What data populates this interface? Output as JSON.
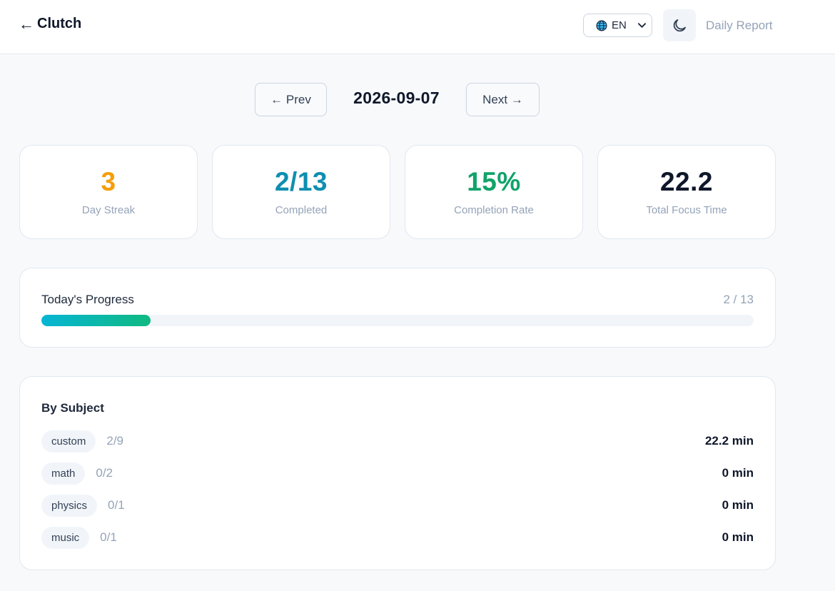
{
  "header": {
    "back_arrow": "←",
    "app_name": "Clutch",
    "language": "EN",
    "title": "Daily Report"
  },
  "date_nav": {
    "prev_label": "← Prev",
    "date": "2026-09-07",
    "next_label": "Next →"
  },
  "stats": [
    {
      "value": "3",
      "label": "Day Streak",
      "color": "#f59e0b"
    },
    {
      "value": "2/13",
      "label": "Completed",
      "color": "#0e8fb0"
    },
    {
      "value": "15%",
      "label": "Completion Rate",
      "color": "#10a36a"
    },
    {
      "value": "22.2",
      "label": "Total Focus Time",
      "color": "#0f172a"
    }
  ],
  "progress": {
    "title": "Today's Progress",
    "count": "2 / 13",
    "fraction": 0.1538
  },
  "by_subject": {
    "title": "By Subject",
    "rows": [
      {
        "subject": "custom",
        "count": "2/9",
        "time": "22.2 min"
      },
      {
        "subject": "math",
        "count": "0/2",
        "time": "0 min"
      },
      {
        "subject": "physics",
        "count": "0/1",
        "time": "0 min"
      },
      {
        "subject": "music",
        "count": "0/1",
        "time": "0 min"
      }
    ]
  },
  "icons": {
    "language": "globe-icon",
    "dropdown": "chevron-down-icon",
    "theme": "moon-icon"
  },
  "colors": {
    "accent_progress_start": "#06b6d4",
    "accent_progress_end": "#10b981"
  }
}
